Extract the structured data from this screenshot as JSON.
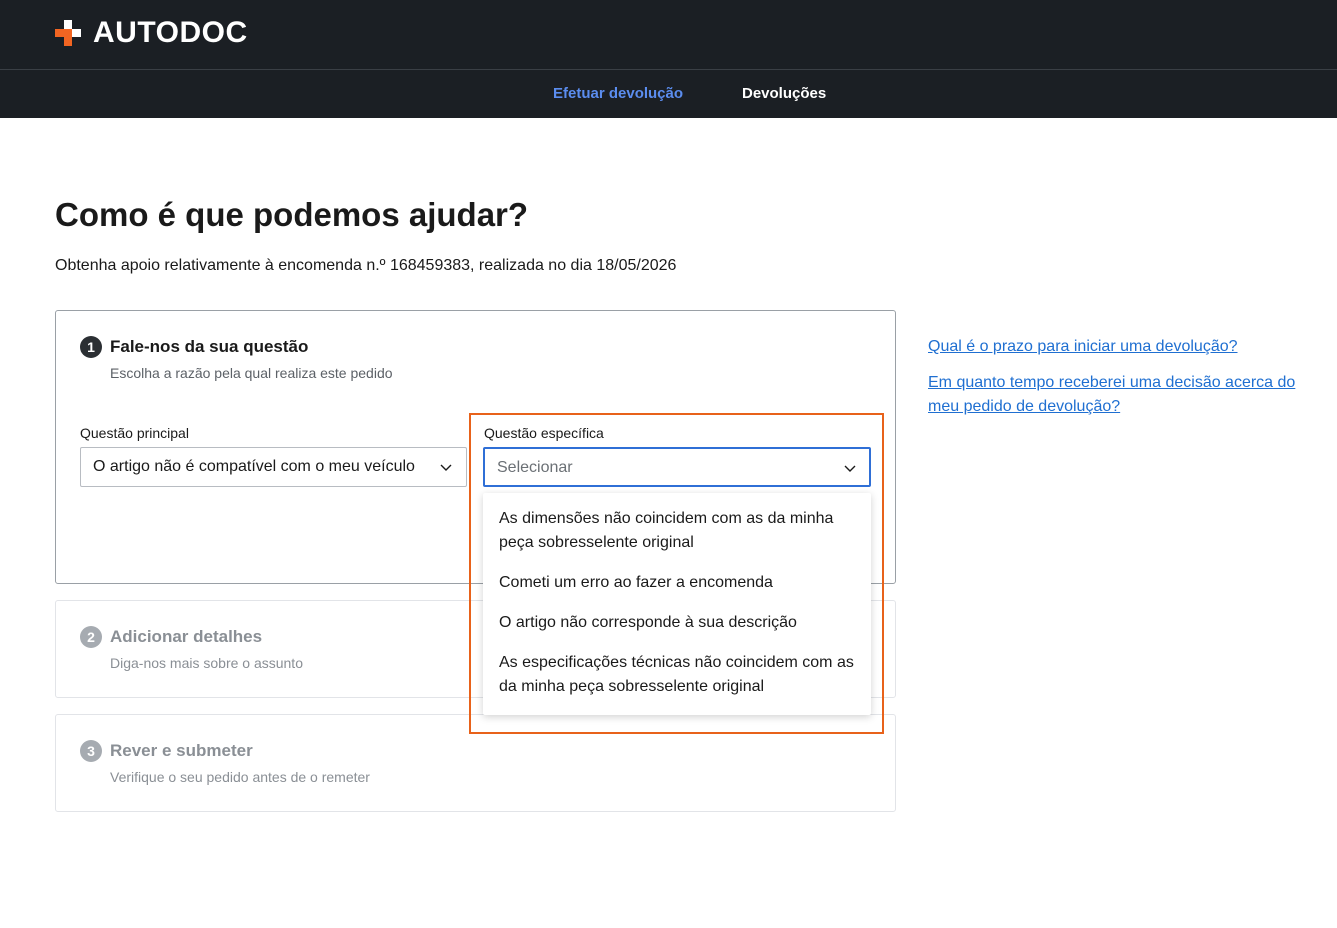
{
  "brand": {
    "name": "AUTODOC",
    "accent": "#f26522",
    "header_bg": "#1b1f24"
  },
  "nav": {
    "items": [
      {
        "label": "Efetuar devolução",
        "active": true
      },
      {
        "label": "Devoluções",
        "active": false
      }
    ]
  },
  "page": {
    "title": "Como é que podemos ajudar?",
    "subtitle": "Obtenha apoio relativamente à encomenda n.º 168459383, realizada no dia 18/05/2026"
  },
  "steps": [
    {
      "number": "1",
      "title": "Fale-nos da sua questão",
      "description": "Escolha a razão pela qual realiza este pedido",
      "state": "active"
    },
    {
      "number": "2",
      "title": "Adicionar detalhes",
      "description": "Diga-nos mais sobre o assunto",
      "state": "inactive"
    },
    {
      "number": "3",
      "title": "Rever e submeter",
      "description": "Verifique o seu pedido antes de o remeter",
      "state": "inactive"
    }
  ],
  "form": {
    "main_question": {
      "label": "Questão principal",
      "value": "O artigo não é compatível com o meu veículo"
    },
    "specific_question": {
      "label": "Questão específica",
      "placeholder": "Selecionar",
      "options": [
        "As dimensões não coincidem com as da minha peça sobresselente original",
        "Cometi um erro ao fazer a encomenda",
        "O artigo não corresponde à sua descrição",
        "As especificações técnicas não coincidem com as da minha peça sobresselente original"
      ]
    }
  },
  "faq": [
    "Qual é o prazo para iniciar uma devolução?",
    "Em quanto tempo receberei uma decisão acerca do meu pedido de devolução?"
  ],
  "icons": {
    "dropdown": "chevron-down-icon",
    "logo": "plus-logo-icon"
  },
  "colors": {
    "link": "#1f6fd1",
    "focus": "#2f6fd6",
    "highlight": "#e8621a",
    "nav_active": "#5b8def"
  }
}
